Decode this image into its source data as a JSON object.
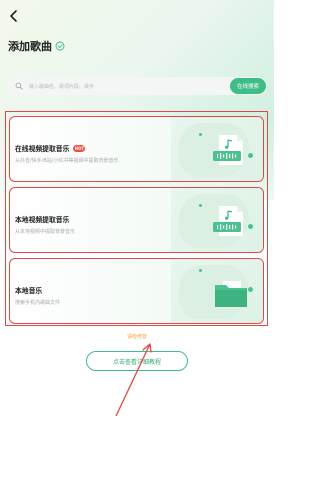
{
  "header": {
    "title": "添加歌曲"
  },
  "search": {
    "placeholder": "输入歌曲名、歌词片段、歌手",
    "button_label": "在线搜索"
  },
  "cards": [
    {
      "title": "在线视频提取音乐",
      "subtitle": "从抖音/快手/B站/小红书等视频中提取背景音乐",
      "badge": "HOT",
      "icon": "music-file-waveform-icon"
    },
    {
      "title": "本地视频提取音乐",
      "subtitle": "从本地视频中提取背景音乐",
      "icon": "music-file-waveform-icon"
    },
    {
      "title": "本地音乐",
      "subtitle": "搜索手机内歌曲文件",
      "icon": "folder-icon"
    }
  ],
  "hint": "请检修音",
  "tutorial_button": "点击查看详细教程",
  "colors": {
    "accent": "#3fbd86",
    "annotation_red": "#e24747",
    "hint_orange": "#f0a23a"
  }
}
